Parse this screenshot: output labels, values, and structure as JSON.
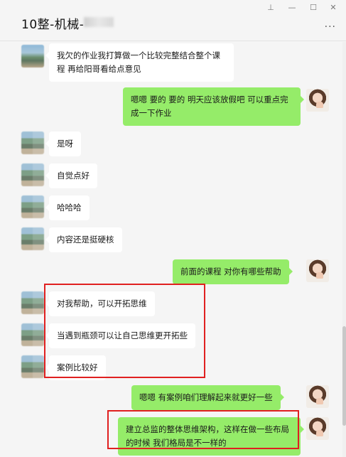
{
  "window": {
    "title": "10整-机械-",
    "pin_icon": "pin-icon",
    "minimize_icon": "minimize-icon",
    "maximize_icon": "maximize-icon",
    "close_icon": "close-icon",
    "pin_glyph": "⊥",
    "minimize_glyph": "—",
    "maximize_glyph": "☐",
    "close_glyph": "✕",
    "more_glyph": "···"
  },
  "colors": {
    "incoming_bubble": "#ffffff",
    "outgoing_bubble": "#95ec69",
    "highlight_box": "#e02020",
    "background": "#f5f5f5"
  },
  "messages": [
    {
      "side": "in",
      "text": "我欠的作业我打算做一个比较完整结合整个课程 再给阳哥看给点意见"
    },
    {
      "side": "out",
      "text": "嗯嗯 要的 要的   明天应该放假吧  可以重点完成一下作业"
    },
    {
      "side": "in",
      "text": "是呀"
    },
    {
      "side": "in",
      "text": "自觉点好"
    },
    {
      "side": "in",
      "text": "哈哈哈"
    },
    {
      "side": "in",
      "text": "内容还是挺硬核"
    },
    {
      "side": "out",
      "text": "前面的课程 对你有哪些帮助"
    },
    {
      "side": "in",
      "text": "对我帮助，可以开拓思维"
    },
    {
      "side": "in",
      "text": "当遇到瓶颈可以让自己思维更开拓些"
    },
    {
      "side": "in",
      "text": "案例比较好"
    },
    {
      "side": "out",
      "text": "嗯嗯   有案例咱们理解起来就更好一些"
    },
    {
      "side": "out",
      "text": "建立总监的整体思维架构，这样在做一些布局的时候  我们格局是不一样的"
    }
  ]
}
